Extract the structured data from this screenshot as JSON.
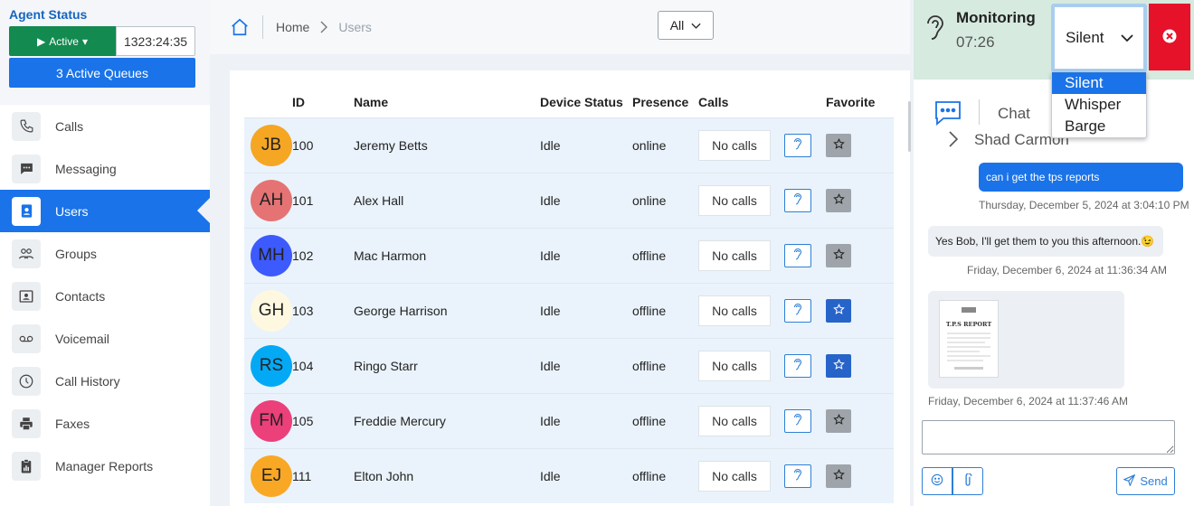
{
  "agent": {
    "title": "Agent Status",
    "status_label": "Active",
    "timer": "1323:24:35",
    "queues_label": "3 Active Queues"
  },
  "nav": {
    "items": [
      {
        "label": "Calls",
        "icon": "phone-icon"
      },
      {
        "label": "Messaging",
        "icon": "message-icon"
      },
      {
        "label": "Users",
        "icon": "user-badge-icon",
        "active": true
      },
      {
        "label": "Groups",
        "icon": "groups-icon"
      },
      {
        "label": "Contacts",
        "icon": "contact-card-icon"
      },
      {
        "label": "Voicemail",
        "icon": "voicemail-icon"
      },
      {
        "label": "Call History",
        "icon": "clock-icon"
      },
      {
        "label": "Faxes",
        "icon": "printer-icon"
      },
      {
        "label": "Manager Reports",
        "icon": "clipboard-icon"
      }
    ]
  },
  "breadcrumb": {
    "home": "Home",
    "current": "Users"
  },
  "filter": {
    "value": "All"
  },
  "table": {
    "headers": {
      "id": "ID",
      "name": "Name",
      "device_status": "Device Status",
      "presence": "Presence",
      "calls": "Calls",
      "favorite": "Favorite"
    },
    "rows": [
      {
        "initials": "JB",
        "avatar_color": "#f5a623",
        "id": "100",
        "name": "Jeremy Betts",
        "device_status": "Idle",
        "presence": "online",
        "calls": "No calls",
        "favorite": false
      },
      {
        "initials": "AH",
        "avatar_color": "#e57373",
        "id": "101",
        "name": "Alex Hall",
        "device_status": "Idle",
        "presence": "online",
        "calls": "No calls",
        "favorite": false
      },
      {
        "initials": "MH",
        "avatar_color": "#3d5afe",
        "id": "102",
        "name": "Mac Harmon",
        "device_status": "Idle",
        "presence": "offline",
        "calls": "No calls",
        "favorite": false
      },
      {
        "initials": "GH",
        "avatar_color": "#fff8e1",
        "id": "103",
        "name": "George Harrison",
        "device_status": "Idle",
        "presence": "offline",
        "calls": "No calls",
        "favorite": true
      },
      {
        "initials": "RS",
        "avatar_color": "#03a9f4",
        "id": "104",
        "name": "Ringo Starr",
        "device_status": "Idle",
        "presence": "offline",
        "calls": "No calls",
        "favorite": true
      },
      {
        "initials": "FM",
        "avatar_color": "#ec407a",
        "id": "105",
        "name": "Freddie Mercury",
        "device_status": "Idle",
        "presence": "offline",
        "calls": "No calls",
        "favorite": false
      },
      {
        "initials": "EJ",
        "avatar_color": "#f9a825",
        "id": "111",
        "name": "Elton John",
        "device_status": "Idle",
        "presence": "offline",
        "calls": "No calls",
        "favorite": false
      }
    ]
  },
  "monitoring": {
    "title": "Monitoring",
    "time": "07:26",
    "mode": "Silent",
    "options": [
      "Silent",
      "Whisper",
      "Barge"
    ]
  },
  "chat": {
    "label": "Chat",
    "contact": "Shad Carmon",
    "messages": {
      "m1": {
        "text": "can i get the tps reports",
        "time": "Thursday, December 5, 2024 at 3:04:10 PM"
      },
      "m2": {
        "text": "Yes Bob, I'll get them to you this afternoon.😉",
        "time": "Friday, December 6, 2024 at 11:36:34 AM"
      },
      "m3": {
        "doc_title": "T.P.S REPORT",
        "time": "Friday, December 6, 2024 at 11:37:46 AM"
      }
    },
    "send_label": "Send"
  },
  "colors": {
    "accent": "#1a73e8",
    "active_status": "#138a4f",
    "close": "#e5122a",
    "monitor_bg": "#d6eadf"
  }
}
